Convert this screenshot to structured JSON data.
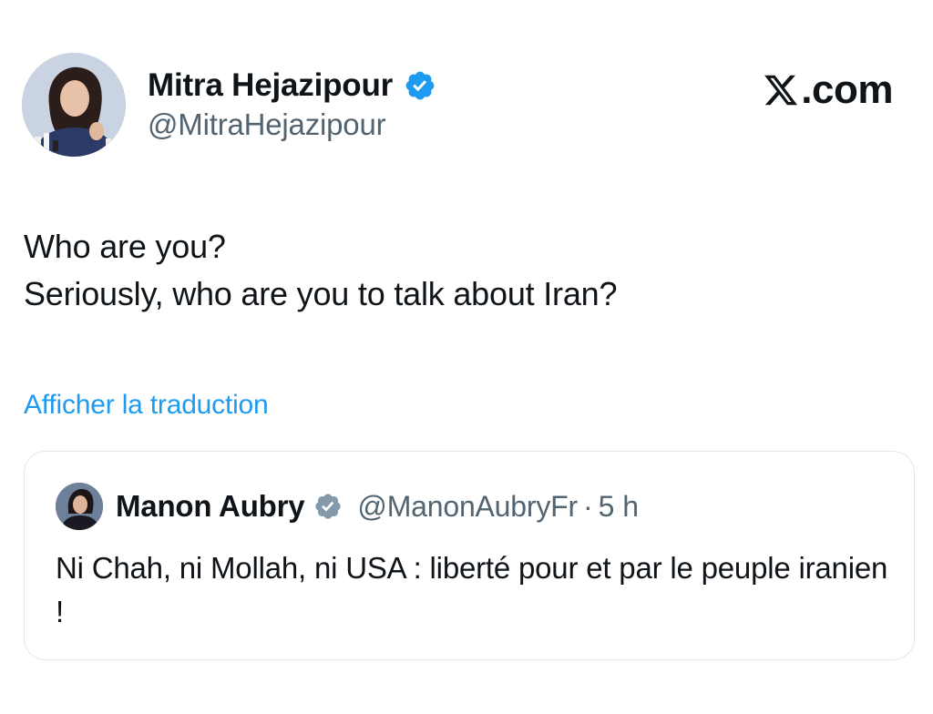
{
  "brand": {
    "text": ".com",
    "icon": "x-logo-icon"
  },
  "tweet": {
    "author": {
      "name": "Mitra Hejazipour",
      "handle": "@MitraHejazipour",
      "verified_icon": "verified-badge-icon",
      "verified_color": "#1d9bf0"
    },
    "lines": [
      "Who are you?",
      "Seriously, who are you to talk about Iran?"
    ],
    "translate_label": "Afficher la traduction"
  },
  "quoted_tweet": {
    "author": {
      "name": "Manon Aubry",
      "handle": "@ManonAubryFr",
      "verified_icon": "verified-badge-icon",
      "verified_color": "#829aab"
    },
    "separator": "·",
    "time": "5 h",
    "text": "Ni Chah, ni Mollah, ni USA : liberté pour et par le peuple iranien !"
  },
  "colors": {
    "text": "#0f1419",
    "secondary": "#536471",
    "link": "#1d9bf0",
    "border": "#e1e8ed"
  }
}
